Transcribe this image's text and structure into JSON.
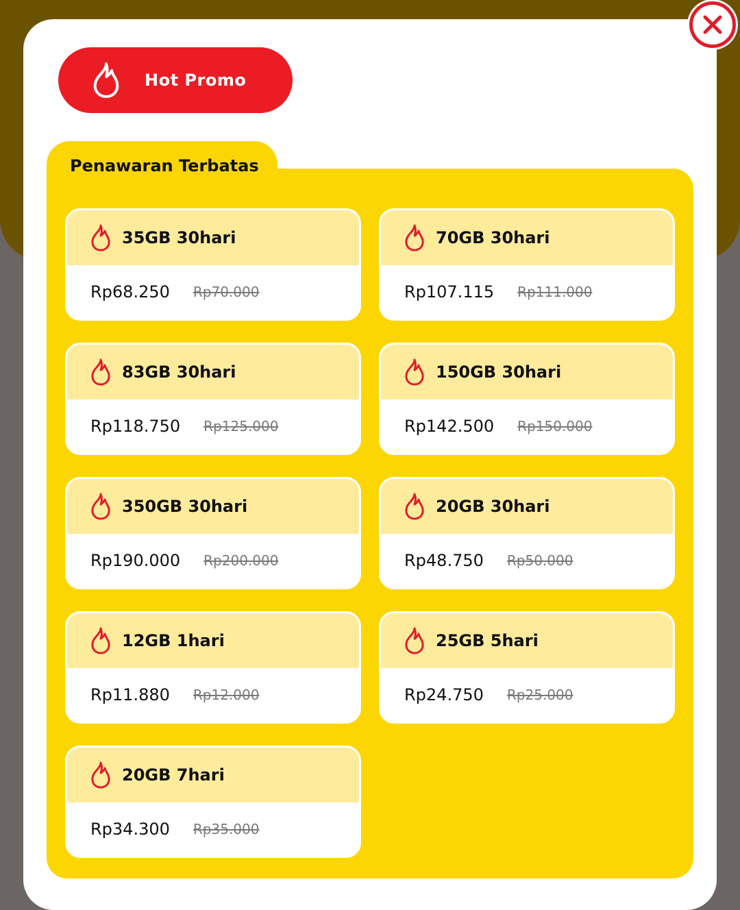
{
  "header": {
    "hot_promo_label": "Hot Promo",
    "close_icon": "close-icon",
    "flame_icon": "flame-icon"
  },
  "section": {
    "title": "Penawaran Terbatas"
  },
  "offers": [
    {
      "name": "35GB 30hari",
      "price": "Rp68.250",
      "old_price": "Rp70.000"
    },
    {
      "name": "70GB 30hari",
      "price": "Rp107.115",
      "old_price": "Rp111.000"
    },
    {
      "name": "83GB 30hari",
      "price": "Rp118.750",
      "old_price": "Rp125.000"
    },
    {
      "name": "150GB 30hari",
      "price": "Rp142.500",
      "old_price": "Rp150.000"
    },
    {
      "name": "350GB 30hari",
      "price": "Rp190.000",
      "old_price": "Rp200.000"
    },
    {
      "name": "20GB 30hari",
      "price": "Rp48.750",
      "old_price": "Rp50.000"
    },
    {
      "name": "12GB 1hari",
      "price": "Rp11.880",
      "old_price": "Rp12.000"
    },
    {
      "name": "25GB 5hari",
      "price": "Rp24.750",
      "old_price": "Rp25.000"
    },
    {
      "name": "20GB 7hari",
      "price": "Rp34.300",
      "old_price": "Rp35.000"
    }
  ],
  "colors": {
    "accent_red": "#ec1c24",
    "panel_yellow": "#fcd602",
    "card_header": "#ffeb9c"
  }
}
